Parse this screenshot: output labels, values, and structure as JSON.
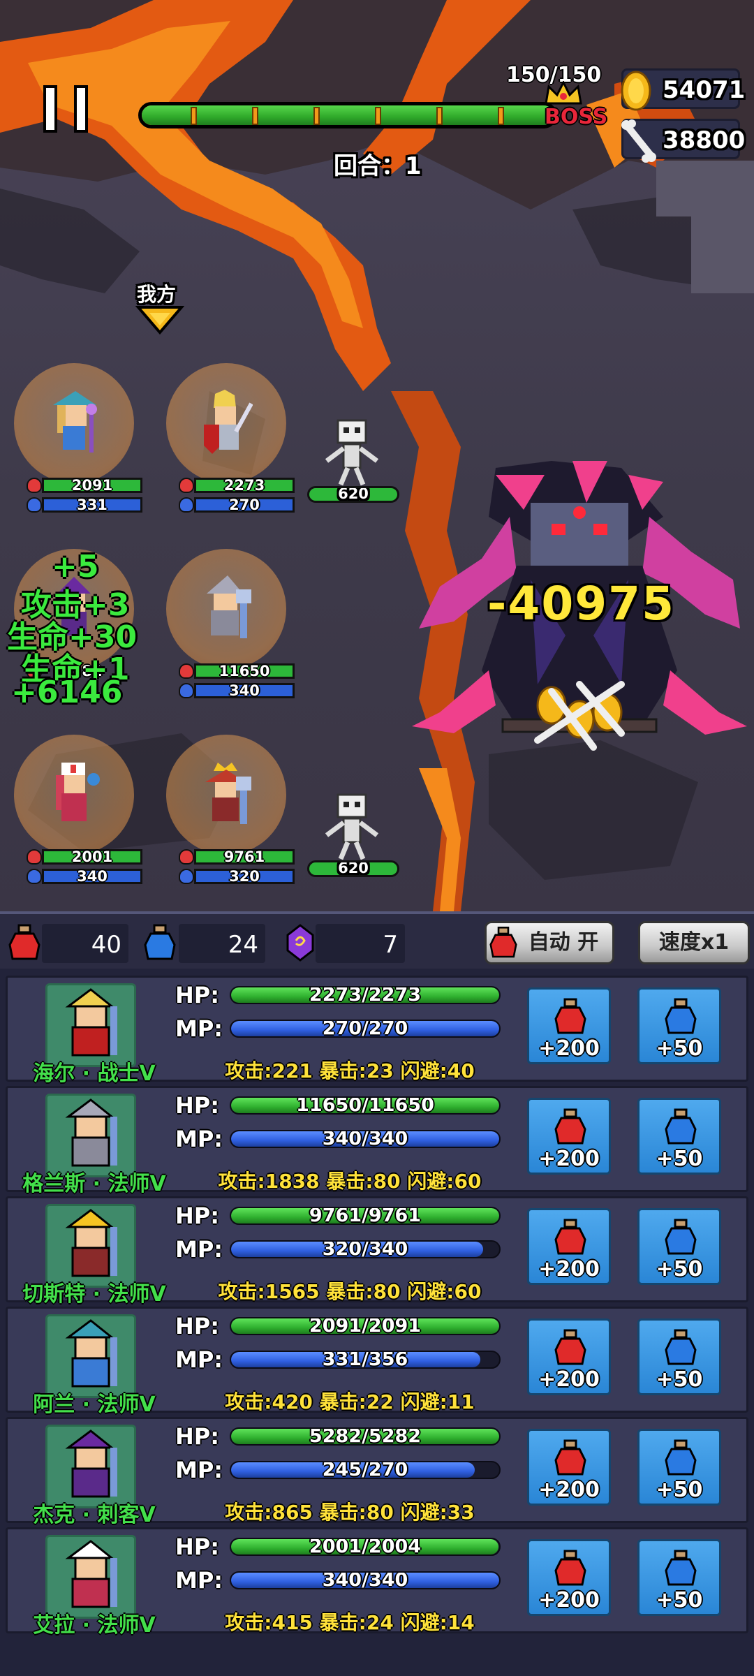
{
  "hud": {
    "boss_hp_text": "150/150",
    "boss_label": "BOSS",
    "gold": "54071",
    "bones": "38800",
    "round_text": "回合：1",
    "wave_progress": 1.0
  },
  "battle": {
    "side_label": "我方",
    "damage_text": "-40975",
    "buff_lines": [
      "+5",
      "攻击+3",
      "生命+30",
      "生命+1",
      "+6146"
    ],
    "heroes": [
      {
        "hp": "2091",
        "mp": "331"
      },
      {
        "hp": "2273",
        "mp": "270"
      },
      {
        "hp": "82",
        "mp": ""
      },
      {
        "hp": "11650",
        "mp": "340"
      },
      {
        "hp": "2001",
        "mp": "340"
      },
      {
        "hp": "9761",
        "mp": "320"
      }
    ],
    "skeletons": [
      "620",
      "620"
    ]
  },
  "resources": {
    "red_potions": "40",
    "blue_potions": "24",
    "purple_orbs": "7",
    "auto_button": "自动 开",
    "speed_button": "速度x1"
  },
  "labels": {
    "hp": "HP:",
    "mp": "MP:",
    "hp_potion": "+200",
    "mp_potion": "+50"
  },
  "party": [
    {
      "name": "海尔 · 战士Ⅴ",
      "hp": "2273/2273",
      "hp_frac": 1.0,
      "mp": "270/270",
      "mp_frac": 1.0,
      "stats": "攻击:221  暴击:23  闪避:40"
    },
    {
      "name": "格兰斯 · 法师Ⅴ",
      "hp": "11650/11650",
      "hp_frac": 1.0,
      "mp": "340/340",
      "mp_frac": 1.0,
      "stats": "攻击:1838  暴击:80  闪避:60"
    },
    {
      "name": "切斯特 · 法师Ⅴ",
      "hp": "9761/9761",
      "hp_frac": 1.0,
      "mp": "320/340",
      "mp_frac": 0.94,
      "stats": "攻击:1565  暴击:80  闪避:60"
    },
    {
      "name": "阿兰 · 法师Ⅴ",
      "hp": "2091/2091",
      "hp_frac": 1.0,
      "mp": "331/356",
      "mp_frac": 0.93,
      "stats": "攻击:420  暴击:22  闪避:11"
    },
    {
      "name": "杰克 · 刺客Ⅴ",
      "hp": "5282/5282",
      "hp_frac": 1.0,
      "mp": "245/270",
      "mp_frac": 0.91,
      "stats": "攻击:865  暴击:80  闪避:33"
    },
    {
      "name": "艾拉 · 法师Ⅴ",
      "hp": "2001/2004",
      "hp_frac": 0.998,
      "mp": "340/340",
      "mp_frac": 1.0,
      "stats": "攻击:415  暴击:24  闪避:14"
    }
  ],
  "colors": {
    "hp": "#2fb02f",
    "mp": "#2f5fe0",
    "accent_yellow": "#ffe83a",
    "boss_red": "#e8263a"
  }
}
